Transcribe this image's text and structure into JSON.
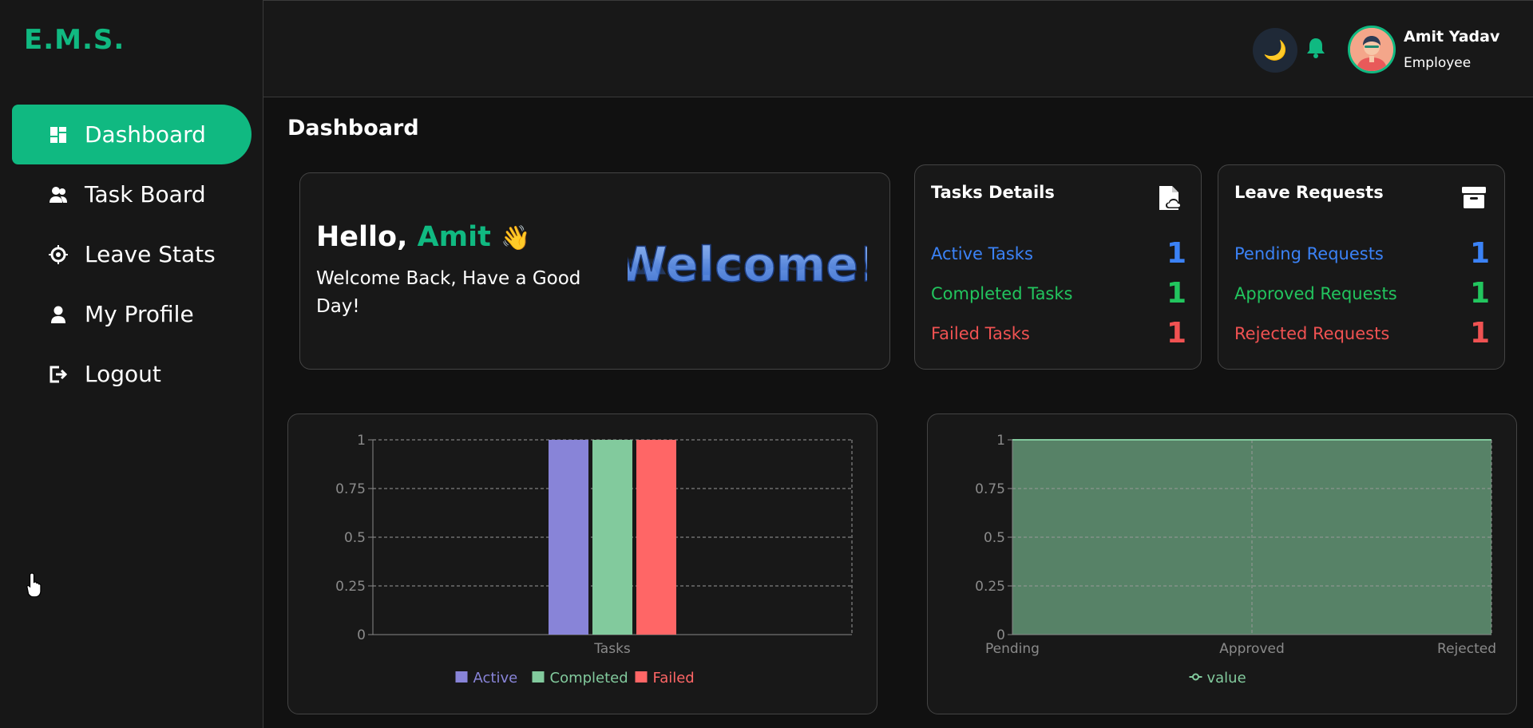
{
  "app": {
    "logo": "E.M.S."
  },
  "sidebar": {
    "items": [
      {
        "label": "Dashboard",
        "icon": "dashboard-icon",
        "active": true
      },
      {
        "label": "Task Board",
        "icon": "users-icon",
        "active": false
      },
      {
        "label": "Leave Stats",
        "icon": "crosshair-icon",
        "active": false
      },
      {
        "label": "My Profile",
        "icon": "user-icon",
        "active": false
      },
      {
        "label": "Logout",
        "icon": "logout-icon",
        "active": false
      }
    ]
  },
  "header": {
    "theme_icon": "🌙",
    "user": {
      "name": "Amit Yadav",
      "role": "Employee"
    }
  },
  "page": {
    "title": "Dashboard"
  },
  "welcome": {
    "greeting": "Hello, ",
    "name": "Amit",
    "wave": "👋",
    "message": "Welcome Back, Have a Good Day!",
    "banner_text": "Welcome!"
  },
  "tasks_details": {
    "title": "Tasks Details",
    "rows": [
      {
        "label": "Active Tasks",
        "value": "1",
        "color": "#3b82f6"
      },
      {
        "label": "Completed Tasks",
        "value": "1",
        "color": "#22c55e"
      },
      {
        "label": "Failed Tasks",
        "value": "1",
        "color": "#f05252"
      }
    ]
  },
  "leave_requests": {
    "title": "Leave Requests",
    "rows": [
      {
        "label": "Pending Requests",
        "value": "1",
        "color": "#3b82f6"
      },
      {
        "label": "Approved Requests",
        "value": "1",
        "color": "#22c55e"
      },
      {
        "label": "Rejected Requests",
        "value": "1",
        "color": "#f05252"
      }
    ]
  },
  "chart_data": [
    {
      "type": "bar",
      "categories": [
        "Tasks"
      ],
      "series": [
        {
          "name": "Active",
          "values": [
            1
          ],
          "color": "#8884d8"
        },
        {
          "name": "Completed",
          "values": [
            1
          ],
          "color": "#82ca9d"
        },
        {
          "name": "Failed",
          "values": [
            1
          ],
          "color": "#ff6666"
        }
      ],
      "yticks": [
        "0",
        "0.25",
        "0.5",
        "0.75",
        "1"
      ],
      "ylim": [
        0,
        1
      ],
      "grid": true,
      "legend": "bottom"
    },
    {
      "type": "area",
      "categories": [
        "Pending",
        "Approved",
        "Rejected"
      ],
      "series": [
        {
          "name": "value",
          "values": [
            1,
            1,
            1
          ],
          "color": "#82ca9d"
        }
      ],
      "yticks": [
        "0",
        "0.25",
        "0.5",
        "0.75",
        "1"
      ],
      "ylim": [
        0,
        1
      ],
      "grid": true,
      "legend": "bottom"
    }
  ]
}
